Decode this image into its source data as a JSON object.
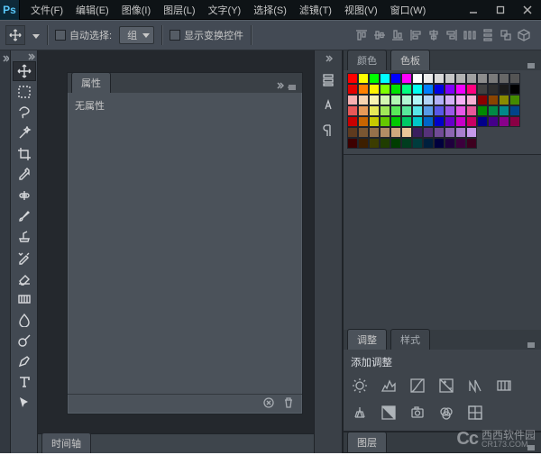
{
  "app": {
    "logo_text": "Ps"
  },
  "menu": {
    "file": "文件(F)",
    "edit": "编辑(E)",
    "image": "图像(I)",
    "layer": "图层(L)",
    "type": "文字(Y)",
    "select": "选择(S)",
    "filter": "滤镜(T)",
    "view": "视图(V)",
    "window": "窗口(W)"
  },
  "options_bar": {
    "auto_select_label": "自动选择:",
    "auto_select_value": "组",
    "show_transform_controls_label": "显示变换控件"
  },
  "panels": {
    "properties": {
      "tab_label": "属性",
      "no_properties": "无属性"
    },
    "timeline": {
      "tab_label": "时间轴"
    },
    "color": {
      "tab_label": "颜色"
    },
    "swatches": {
      "tab_label": "色板"
    },
    "adjustments": {
      "tab_label": "调整",
      "title": "添加调整"
    },
    "styles": {
      "tab_label": "样式"
    },
    "layers": {
      "tab_label": "图层"
    }
  },
  "watermark": {
    "logo": "Cc",
    "text": "西西软件园",
    "url": "CR173.COM"
  }
}
